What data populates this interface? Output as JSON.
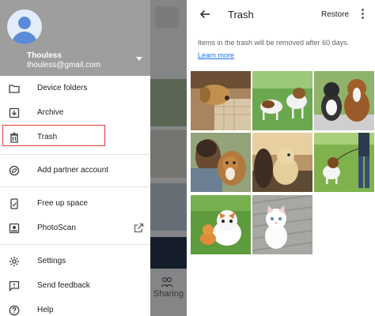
{
  "drawer": {
    "account": {
      "name": "Thouless",
      "email": "thouless@gmail.com"
    },
    "items": [
      {
        "label": "Device folders",
        "icon": "folder-icon"
      },
      {
        "label": "Archive",
        "icon": "archive-icon"
      },
      {
        "label": "Trash",
        "icon": "trash-icon"
      },
      {
        "label": "Add partner account",
        "icon": "partner-sharing-icon"
      },
      {
        "label": "Free up space",
        "icon": "free-up-space-icon"
      },
      {
        "label": "PhotoScan",
        "icon": "photoscan-icon",
        "trailing_icon": "open-external-icon"
      },
      {
        "label": "Settings",
        "icon": "gear-icon"
      },
      {
        "label": "Send feedback",
        "icon": "feedback-icon"
      },
      {
        "label": "Help",
        "icon": "help-icon"
      }
    ],
    "highlight_color": "#e53935"
  },
  "background_app": {
    "nav_label": "Sharing"
  },
  "trash": {
    "title": "Trash",
    "restore_label": "Restore",
    "info_text": "Items in the trash will be removed after 60 days.",
    "learn_more": "Learn more",
    "accent": "#1a73e8",
    "photos": [
      {
        "subject": "puppy lying on pillow"
      },
      {
        "subject": "beagles on grass"
      },
      {
        "subject": "cat and dog"
      },
      {
        "subject": "man with dog"
      },
      {
        "subject": "golden dog by lake"
      },
      {
        "subject": "beagle on leash"
      },
      {
        "subject": "puppy and kitten on grass"
      },
      {
        "subject": "white kitten"
      }
    ]
  }
}
